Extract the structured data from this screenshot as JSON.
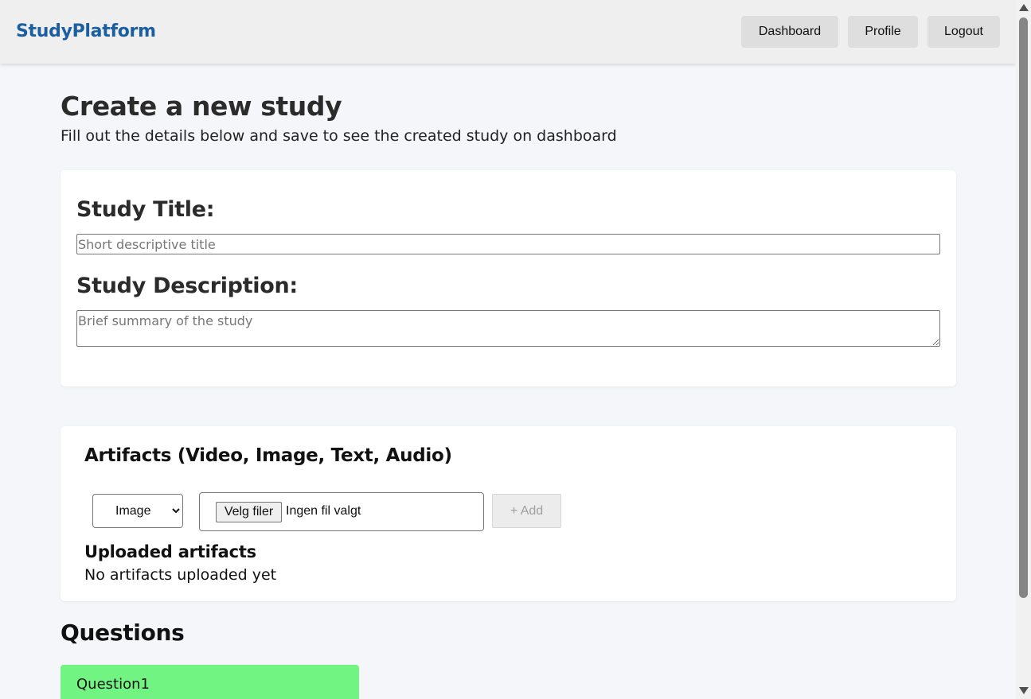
{
  "header": {
    "brand": "StudyPlatform",
    "nav": {
      "dashboard": "Dashboard",
      "profile": "Profile",
      "logout": "Logout"
    }
  },
  "page": {
    "title": "Create a new study",
    "subtitle": "Fill out the details below and save to see the created study on dashboard"
  },
  "details": {
    "title_label": "Study Title:",
    "title_value": "",
    "title_placeholder": "Short descriptive title",
    "description_label": "Study Description:",
    "description_value": "",
    "description_placeholder": "Brief summary of the study"
  },
  "artifacts": {
    "heading": "Artifacts (Video, Image, Text, Audio)",
    "type_selected": "Image",
    "file_button": "Velg filer",
    "file_status": "Ingen fil valgt",
    "add_button": "+ Add",
    "uploaded_heading": "Uploaded artifacts",
    "uploaded_empty": "No artifacts uploaded yet"
  },
  "questions": {
    "heading": "Questions",
    "items": [
      {
        "label": "Question1"
      }
    ]
  },
  "colors": {
    "brand": "#1c5fa0",
    "question_bg": "#72f482",
    "page_bg": "#f5f6f9"
  },
  "icons": {
    "scroll_up": "triangle-up-icon",
    "scroll_down": "triangle-down-icon",
    "select_arrow": "chevron-down-icon"
  }
}
